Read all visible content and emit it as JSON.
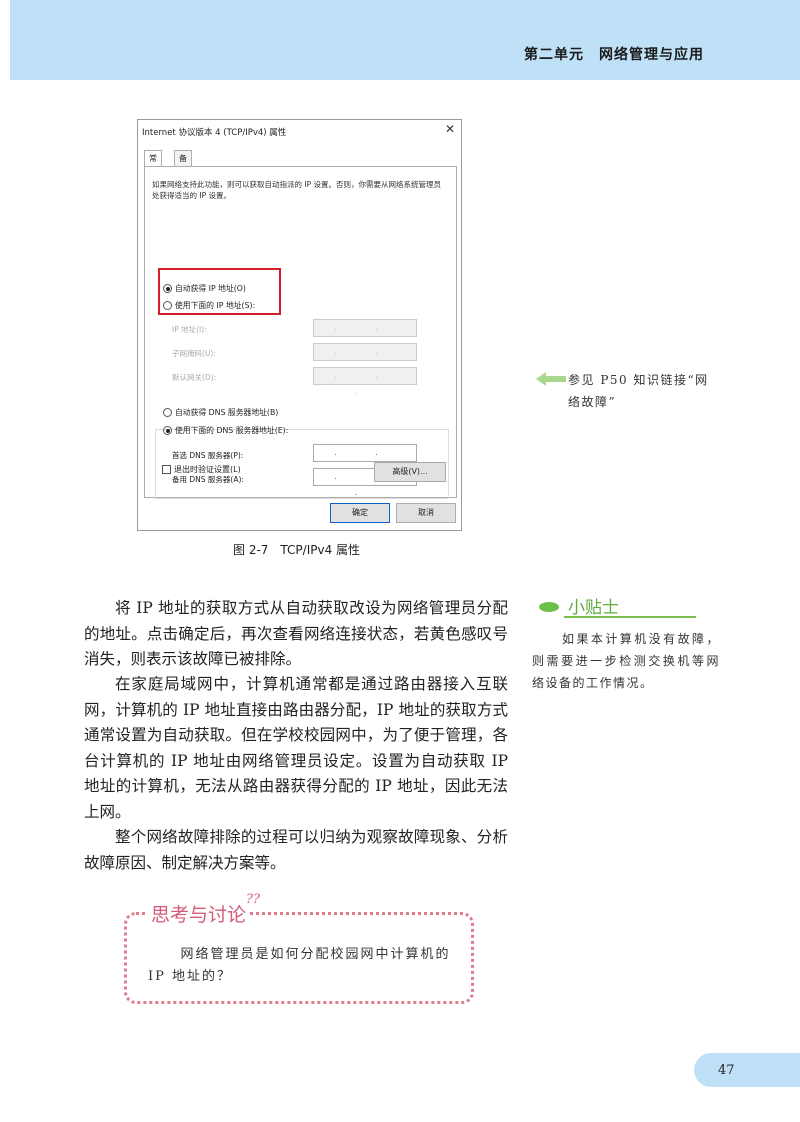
{
  "header": {
    "title": "第二单元　网络管理与应用"
  },
  "dialog": {
    "title": "Internet 协议版本 4 (TCP/IPv4) 属性",
    "close_icon": "close-icon",
    "tabs": [
      "常规",
      "备用配置"
    ],
    "description": "如果网络支持此功能，则可以获取自动指派的 IP 设置。否则，你需要从网络系统管理员处获得适当的 IP 设置。",
    "radio_auto_ip": "自动获得 IP 地址(O)",
    "radio_manual_ip": "使用下面的 IP 地址(S):",
    "label_ip": "IP 地址(I):",
    "label_mask": "子网掩码(U):",
    "label_gateway": "默认网关(D):",
    "ip_dots": ". . .",
    "radio_auto_dns": "自动获得 DNS 服务器地址(B)",
    "radio_manual_dns": "使用下面的 DNS 服务器地址(E):",
    "label_dns1": "首选 DNS 服务器(P):",
    "label_dns2": "备用 DNS 服务器(A):",
    "checkbox_validate": "退出时验证设置(L)",
    "btn_advanced": "高级(V)...",
    "btn_ok": "确定",
    "btn_cancel": "取消"
  },
  "caption": "图 2-7　TCP/IPv4 属性",
  "side_note": "参见 P50 知识链接“网络故障”",
  "paragraphs": [
    "将 IP 地址的获取方式从自动获取改设为网络管理员分配的地址。点击确定后，再次查看网络连接状态，若黄色感叹号消失，则表示该故障已被排除。",
    "在家庭局域网中，计算机通常都是通过路由器接入互联网，计算机的 IP 地址直接由路由器分配，IP 地址的获取方式通常设置为自动获取。但在学校校园网中，为了便于管理，各台计算机的 IP 地址由网络管理员设定。设置为自动获取 IP 地址的计算机，无法从路由器获得分配的 IP 地址，因此无法上网。",
    "整个网络故障排除的过程可以归纳为观察故障现象、分析故障原因、制定解决方案等。"
  ],
  "tips": {
    "title": "小贴士",
    "body": "如果本计算机没有故障，则需要进一步检测交换机等网络设备的工作情况。"
  },
  "think": {
    "title": "思考与讨论",
    "marks": "??",
    "body": "网络管理员是如何分配校园网中计算机的 IP 地址的？"
  },
  "page_number": "47",
  "colors": {
    "header_band": "#bfe1f7",
    "highlight_box": "#d21f2b",
    "tips_green": "#5fae3c",
    "think_pink": "#d45a78"
  }
}
